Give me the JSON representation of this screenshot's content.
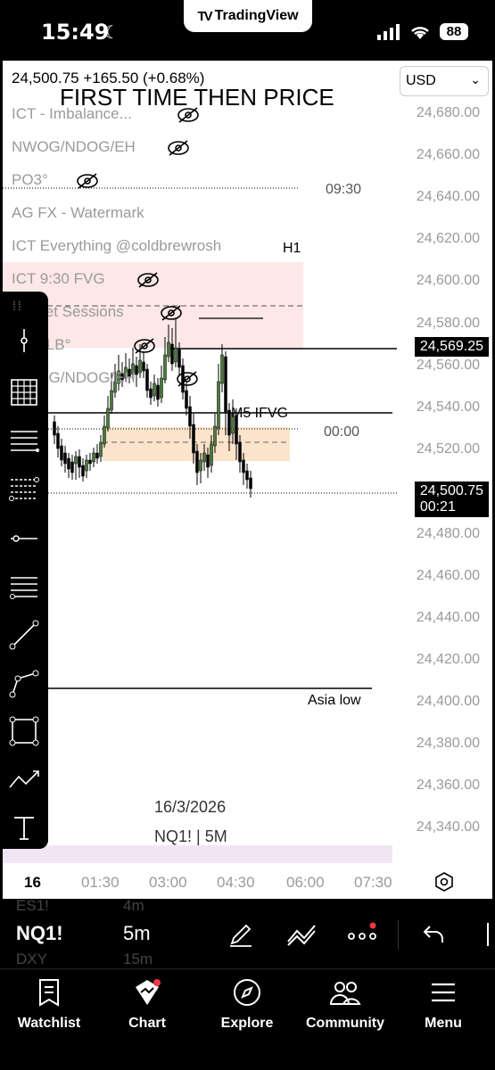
{
  "status_bar": {
    "time": "15:49",
    "app_name": "TradingView",
    "battery": "88"
  },
  "chart": {
    "header_price": "24,500.75 +165.50 (+0.68%)",
    "title": "FIRST TIME THEN PRICE",
    "currency": "USD",
    "indicators": [
      "ICT - Imbalance...",
      "NWOG/NDOG/EH",
      "PO3°",
      "AG FX - Watermark",
      "ICT Everything @coldbrewrosh",
      "ICT 9:30 FVG",
      "Market Sessions",
      "PDA LB°",
      "NWOG/NDOG/EH"
    ],
    "price_scale": [
      "24,680.00",
      "24,660.00",
      "24,640.00",
      "24,620.00",
      "24,600.00",
      "24,580.00",
      "24,560.00",
      "24,540.00",
      "24,520.00",
      "24,480.00",
      "24,460.00",
      "24,440.00",
      "24,420.00",
      "24,400.00",
      "24,380.00",
      "24,360.00",
      "24,340.00"
    ],
    "price_highlight": "24,569.25",
    "current_price": "24,500.75",
    "countdown": "00:21",
    "labels": {
      "t0930": "09:30",
      "h1": "H1",
      "m5_ifvg": "M5 IFVG",
      "t0000": "00:00",
      "asia_low": "Asia low",
      "date": "16/3/2026",
      "symbol_tf": "NQ1! | 5M"
    },
    "time_axis": [
      "16",
      "01:30",
      "03:00",
      "04:30",
      "06:00",
      "07:30"
    ],
    "colors": {
      "up_candle": "#4a7a3a",
      "down_candle": "#000000",
      "fvg_zone": "#fbe3cc",
      "h1_zone": "#fde7e7",
      "session_band": "#efe6f5"
    }
  },
  "toolbar": {
    "tools": [
      "vertical-line-icon",
      "grid-icon",
      "horizontal-lines-icon",
      "fib-icon",
      "horizontal-ray-icon",
      "fib-levels-icon",
      "trend-line-icon",
      "path-icon",
      "rectangle-icon",
      "forecast-icon",
      "text-icon"
    ]
  },
  "symbol_bar": {
    "symbol": "NQ1!",
    "timeframe": "5m",
    "ghost_above": "ES1!",
    "ghost_above_tf": "4m",
    "ghost_below": "DXY",
    "ghost_below_tf": "15m"
  },
  "bottom_nav": [
    {
      "label": "Watchlist",
      "icon": "watchlist-icon"
    },
    {
      "label": "Chart",
      "icon": "chart-icon"
    },
    {
      "label": "Explore",
      "icon": "compass-icon"
    },
    {
      "label": "Community",
      "icon": "community-icon"
    },
    {
      "label": "Menu",
      "icon": "menu-icon"
    }
  ]
}
